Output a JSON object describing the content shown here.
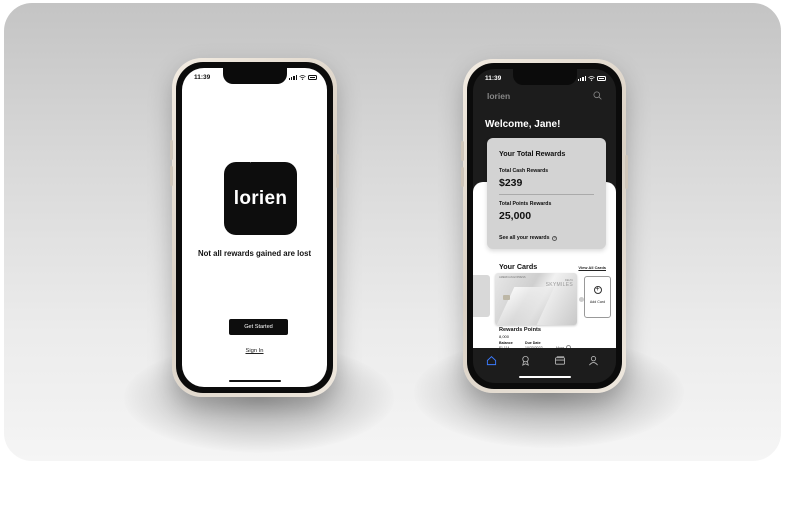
{
  "left_phone": {
    "status": {
      "time": "11:39"
    },
    "logo": {
      "wordmark": "lorien",
      "sparkle_glyph": "✦"
    },
    "tagline": "Not all rewards gained are lost",
    "get_started_label": "Get Started",
    "sign_in_label": "Sign In"
  },
  "right_phone": {
    "status": {
      "time": "11:39"
    },
    "header": {
      "brand": "lorien",
      "search_icon": "search-icon"
    },
    "welcome": "Welcome, Jane!",
    "total_rewards": {
      "title": "Your Total Rewards",
      "cash_label": "Total Cash Rewards",
      "cash_value": "$239",
      "points_label": "Total Points Rewards",
      "points_value": "25,000",
      "see_all_label": "See all your rewards"
    },
    "cards": {
      "title": "Your Cards",
      "view_all_label": "View All Cards",
      "card": {
        "issuer": "AMERICAN EXPRESS",
        "partner": "DELTA",
        "program": "SKYMILES"
      },
      "add_card_label": "Add Card"
    },
    "rewards_points": {
      "title": "Rewards Points",
      "value": "8,000",
      "balance_label": "Balance",
      "balance_value": "$1,114",
      "due_label": "Due Date",
      "due_value": "10/23/2022",
      "more_label": "More"
    },
    "tabs": [
      "home-icon",
      "rewards-icon",
      "cards-icon",
      "profile-icon"
    ],
    "active_tab_color": "#3b7bff"
  }
}
